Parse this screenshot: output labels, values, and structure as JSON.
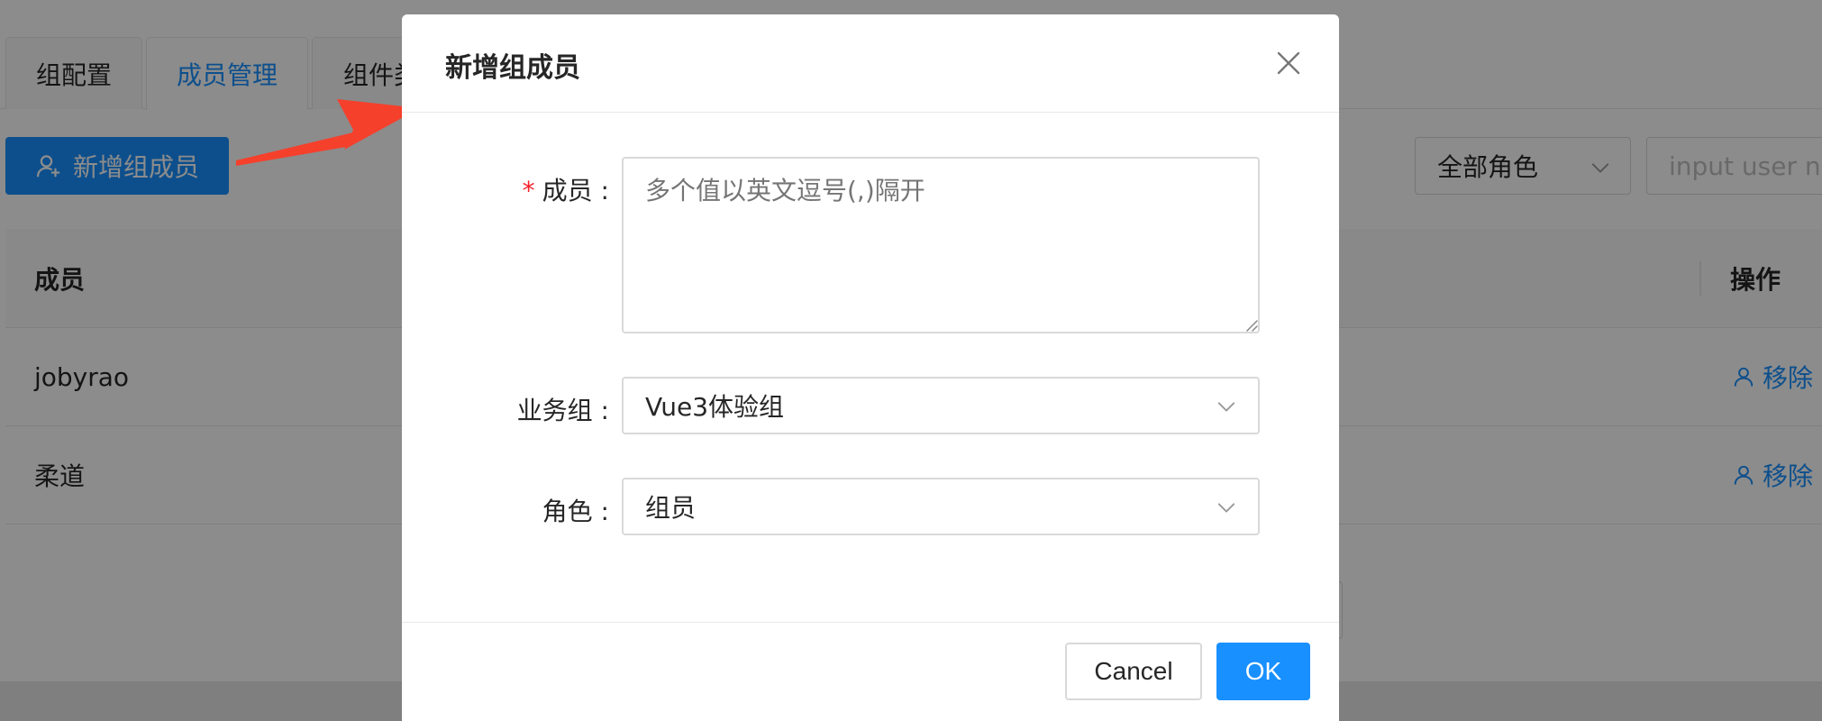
{
  "tabs": [
    {
      "label": "组配置",
      "active": false
    },
    {
      "label": "成员管理",
      "active": true
    },
    {
      "label": "组件类",
      "active": false
    }
  ],
  "toolbar": {
    "add_member_label": "新增组成员",
    "role_filter_value": "全部角色",
    "user_search_placeholder": "input user name"
  },
  "table": {
    "headers": {
      "member": "成员",
      "action": "操作"
    },
    "rows": [
      {
        "member": "jobyrao",
        "action": "移除"
      },
      {
        "member": "柔道",
        "action": "移除"
      }
    ]
  },
  "modal": {
    "title": "新增组成员",
    "fields": {
      "members": {
        "required_mark": "*",
        "label": "成员 :",
        "placeholder": "多个值以英文逗号(,)隔开",
        "value": ""
      },
      "business_group": {
        "label": "业务组 :",
        "value": "Vue3体验组"
      },
      "role": {
        "label": "角色 :",
        "value": "组员"
      }
    },
    "cancel_label": "Cancel",
    "ok_label": "OK"
  },
  "colors": {
    "primary": "#1890ff",
    "required": "#f5222d",
    "annotation_arrow": "#f5402c",
    "mask": "rgba(0,0,0,0.45)"
  },
  "icons": {
    "add_member": "user-add-icon",
    "remove": "user-icon",
    "select": "chevron-down-icon",
    "close": "close-icon",
    "annotation": "arrow-icon"
  }
}
